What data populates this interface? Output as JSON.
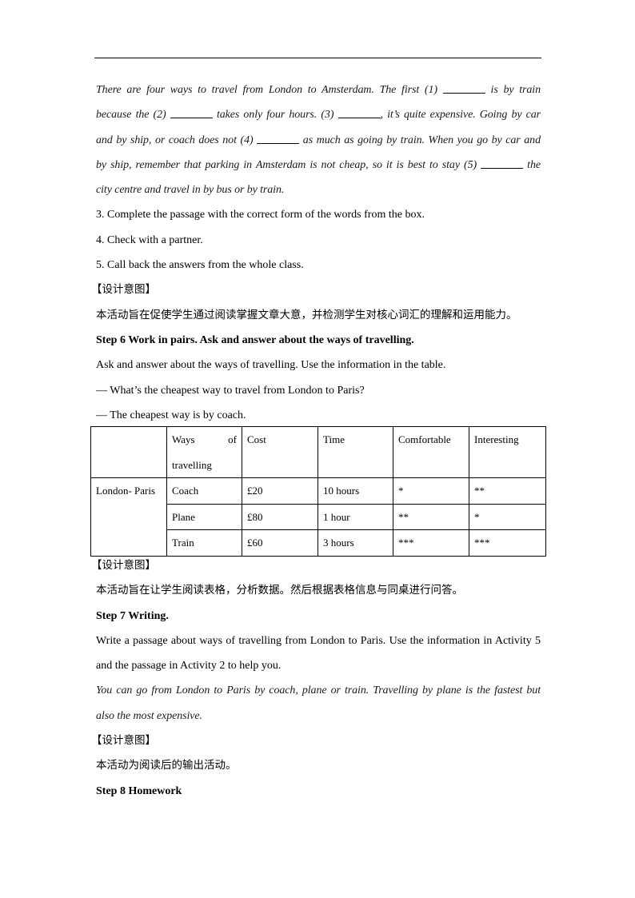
{
  "passage": {
    "lines": [
      [
        "There are four ways to travel from London to Amsterdam. The first (1) ",
        " is by train"
      ],
      [
        "because the (2) ",
        " takes only four hours. (3) ",
        ", it’s quite expensive. Going by car"
      ],
      [
        "and by ship, or coach does not (4) ",
        " as much as going by train. When you go by car and"
      ],
      [
        "by ship, remember that parking in Amsterdam is not cheap, so it is best to stay (5) ",
        " the"
      ],
      [
        "city centre and travel in by bus or by train."
      ]
    ]
  },
  "steps_list": [
    "3. Complete the passage with the correct form of the words from the box.",
    "4. Check with a partner.",
    "5. Call back the answers from the whole class."
  ],
  "design_intent_label": "【设计意图】",
  "intent1": "本活动旨在促使学生通过阅读掌握文章大意，并检测学生对核心词汇的理解和运用能力。",
  "step6": {
    "title": "Step 6 Work in pairs. Ask and answer about the ways of travelling.",
    "instruction": "Ask and answer about the ways of travelling. Use the information in the table.",
    "q": "— What’s the cheapest way to travel from London to Paris?",
    "a": "— The cheapest way is by coach."
  },
  "table": {
    "headers": [
      "",
      "Ways of travelling",
      "Cost",
      "Time",
      "Comfortable",
      "Interesting"
    ],
    "ways_words": [
      "Ways",
      "of"
    ],
    "ways_word2": "travelling",
    "route": "London- Paris",
    "rows": [
      [
        "Coach",
        "£20",
        "10 hours",
        "*",
        "**"
      ],
      [
        "Plane",
        "£80",
        "1 hour",
        "**",
        "*"
      ],
      [
        "Train",
        "£60",
        "3 hours",
        "***",
        "***"
      ]
    ]
  },
  "intent2": "本活动旨在让学生阅读表格，分析数据。然后根据表格信息与同桌进行问答。",
  "step7": {
    "title": "Step 7 Writing.",
    "line1": "Write a passage about ways of travelling from London to Paris. Use the information in Activity 5",
    "line2": "and the passage in Activity 2 to help you.",
    "example1": "You can go from London to Paris by coach, plane or train. Travelling by plane is the fastest but",
    "example2": "also the most expensive."
  },
  "intent3": "本活动为阅读后的输出活动。",
  "step8": {
    "title": "Step 8 Homework"
  }
}
